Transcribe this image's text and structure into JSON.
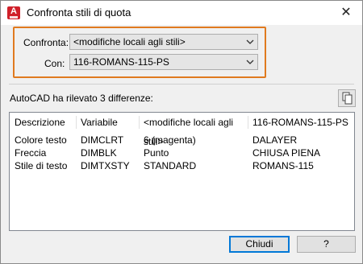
{
  "window": {
    "title": "Confronta stili di quota",
    "close_glyph": "✕",
    "app_icon_letter": "A"
  },
  "compare": {
    "confronta_label": "Confronta:",
    "confronta_value": "<modifiche locali agli stili>",
    "con_label": "Con:",
    "con_value": "116-ROMANS-115-PS"
  },
  "result": {
    "detected_text": "AutoCAD ha rilevato 3 differenze:"
  },
  "table": {
    "headers": [
      "Descrizione",
      "Variabile",
      "<modifiche locali agli stili>",
      "116-ROMANS-115-PS"
    ],
    "rows": [
      [
        "Colore testo",
        "DIMCLRT",
        "6 (magenta)",
        "DALAYER"
      ],
      [
        "Freccia",
        "DIMBLK",
        "Punto",
        "CHIUSA PIENA"
      ],
      [
        "Stile di testo",
        "DIMTXSTY",
        "STANDARD",
        "ROMANS-115"
      ]
    ]
  },
  "buttons": {
    "close_label": "Chiudi",
    "help_label": "?"
  },
  "colors": {
    "highlight_border": "#e07a1f",
    "default_button_border": "#0078d7",
    "app_icon": "#d0202a"
  }
}
